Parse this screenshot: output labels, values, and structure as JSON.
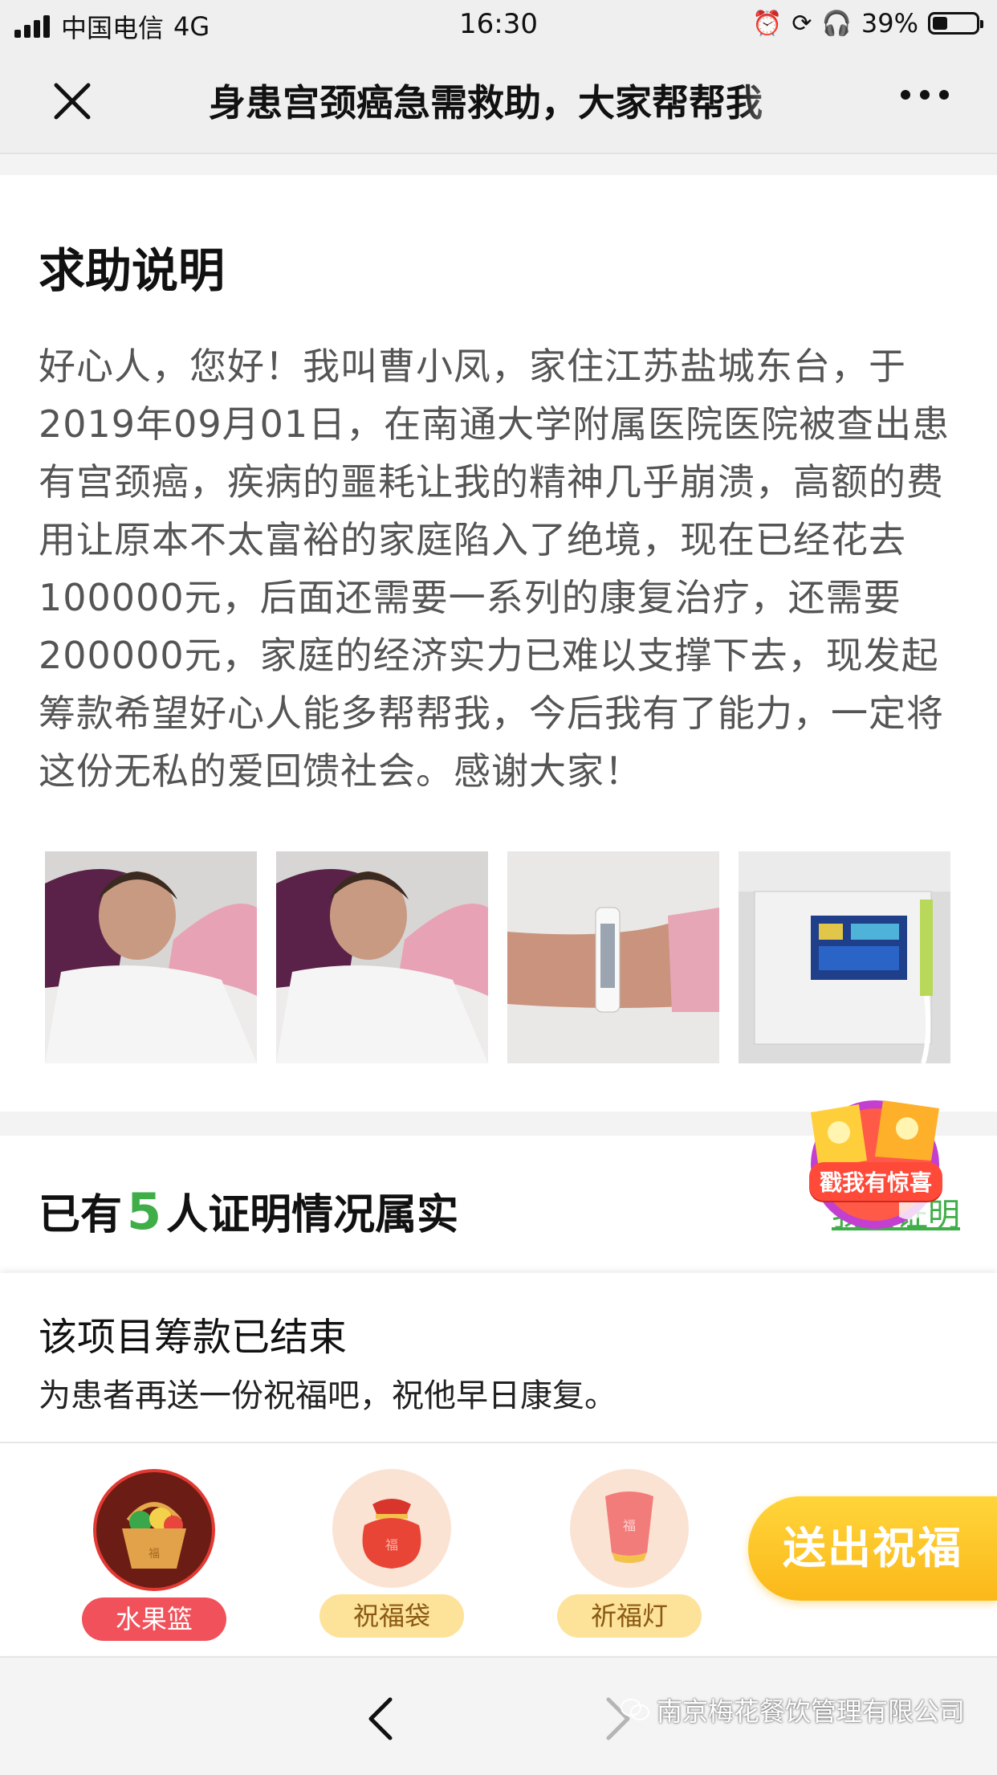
{
  "status_bar": {
    "carrier": "中国电信",
    "network": "4G",
    "time": "16:30",
    "battery": "39%",
    "icons": [
      "signal-icon",
      "alarm-icon",
      "rotation-lock-icon",
      "headphones-icon",
      "battery-icon"
    ]
  },
  "nav": {
    "title": "身患宫颈癌急需救助，大家帮帮我",
    "close_icon": "close-icon",
    "more_icon": "more-icon"
  },
  "description": {
    "heading": "求助说明",
    "body": "好心人，您好！我叫曹小凤，家住江苏盐城东台，于2019年09月01日，在南通大学附属医院医院被查出患有宫颈癌，疾病的噩耗让我的精神几乎崩溃，高额的费用让原本不太富裕的家庭陷入了绝境，现在已经花去100000元，后面还需要一系列的康复治疗，还需要200000元，家庭的经济实力已难以支撑下去，现发起筹款希望好心人能多帮帮我，今后我有了能力，一定将这份无私的爱回馈社会。感谢大家！"
  },
  "verify": {
    "prefix": "已有",
    "count": "5",
    "suffix": "人证明情况属实",
    "link": "我要证明"
  },
  "promo": {
    "label": "戳我有惊喜"
  },
  "panel": {
    "ended_title": "该项目筹款已结束",
    "ended_subtitle": "为患者再送一份祝福吧，祝他早日康复。",
    "gifts": [
      {
        "label": "水果篮",
        "icon": "fruit-basket-icon",
        "selected": true
      },
      {
        "label": "祝福袋",
        "icon": "blessing-bag-icon",
        "selected": false
      },
      {
        "label": "祈福灯",
        "icon": "sky-lantern-icon",
        "selected": false
      }
    ],
    "send_button": "送出祝福"
  },
  "bottom_bar": {
    "back_icon": "back-arrow-icon",
    "forward_icon": "forward-arrow-icon",
    "watermark": "南京梅花餐饮管理有限公司"
  },
  "colors": {
    "accent_green": "#3fae49",
    "send_button": "#fbb81a",
    "selected_gift": "#f0515a"
  }
}
